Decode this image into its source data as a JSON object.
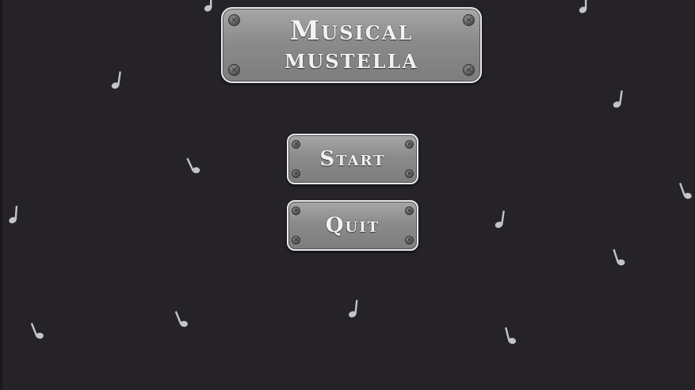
{
  "game": {
    "title_line1": "Musical",
    "title_line2": "mustella"
  },
  "menu": {
    "start_label": "Start",
    "quit_label": "Quit"
  },
  "colors": {
    "background": "#252228",
    "plate_metal": "#8e8e8e",
    "plate_border": "#e8e8e8",
    "note": "#c4c4c4"
  },
  "icons": {
    "screw": "screw-icon",
    "note": "music-note-icon"
  }
}
